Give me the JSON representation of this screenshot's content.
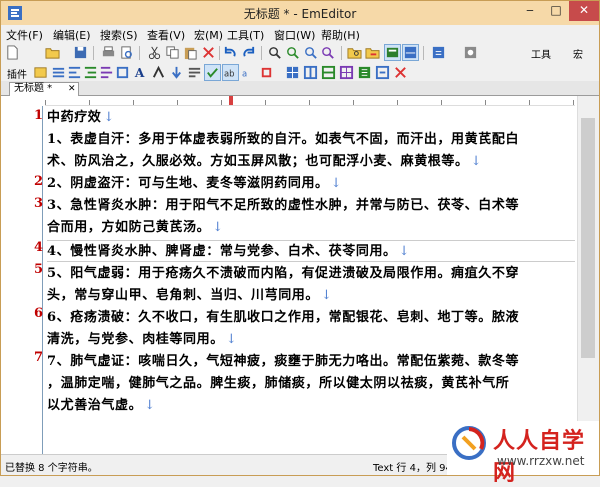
{
  "window": {
    "title": "无标题 * - EmEditor"
  },
  "title_buttons": {
    "minimize": "‒",
    "maximize": "□",
    "close": "✕"
  },
  "menu": [
    "文件(F)",
    "编辑(E)",
    "搜索(S)",
    "查看(V)",
    "宏(M)",
    "工具(T)",
    "窗口(W)",
    "帮助(H)"
  ],
  "toolbar": {
    "tools_label": "工具",
    "macro_label": "宏",
    "plugins_label": "插件"
  },
  "tab": {
    "label": "无标题 *"
  },
  "line_numbers": [
    "1",
    "2",
    "3",
    "4",
    "5",
    "6",
    "7"
  ],
  "lines": [
    {
      "text": "中药疗效",
      "eol": "↓"
    },
    {
      "text": "1、表虚自汗：多用于体虚表弱所致的自汗。如表气不固，而汗出，用黄芪配白",
      "eol": ""
    },
    {
      "text": "术、防风治之，久服必效。方如玉屏风散；也可配浮小麦、麻黄根等。",
      "eol": "↓"
    },
    {
      "text": "2、阴虚盗汗：可与生地、麦冬等滋阴药同用。",
      "eol": "↓"
    },
    {
      "text": "3、急性肾炎水肿：用于阳气不足所致的虚性水肿，并常与防已、茯苓、白术等",
      "eol": ""
    },
    {
      "text": "合而用，方如防己黄芪汤。",
      "eol": "↓"
    },
    {
      "text": "4、慢性肾炎水肿、脾肾虚：常与党参、白术、茯苓同用。",
      "eol": "↓"
    },
    {
      "text": "5、阳气虚弱：用于疮疡久不溃破而内陷，有促进溃破及局限作用。痈疽久不穿",
      "eol": ""
    },
    {
      "text": "头，常与穿山甲、皂角刺、当归、川芎同用。",
      "eol": "↓"
    },
    {
      "text": "6、疮疡溃破：久不收口，有生肌收口之作用，常配银花、皂刺、地丁等。脓液",
      "eol": ""
    },
    {
      "text": "清洗，与党参、肉桂等同用。",
      "eol": "↓"
    },
    {
      "text": "7、肺气虚证：咳喘日久，气短神疲，痰壅于肺无力咯出。常配伍紫菀、款冬等",
      "eol": ""
    },
    {
      "text": "，温肺定喘，健肺气之品。脾生痰，肺储痰，所以健太阴以祛痰，黄芪补气所",
      "eol": ""
    },
    {
      "text": "以尤善治气虚。",
      "eol": "↓"
    }
  ],
  "status": {
    "left": "已替换 8 个字符串。",
    "position": "Text 行 4，列 94"
  },
  "watermark": {
    "title": "人人自学网",
    "url": "www.rrzxw.net"
  },
  "colors": {
    "line_number": "#c00000",
    "eol_mark": "#4f7fd0",
    "close_button": "#c74b4b",
    "title_bar": "#f6d9a8",
    "watermark_red": "#d4231e"
  }
}
